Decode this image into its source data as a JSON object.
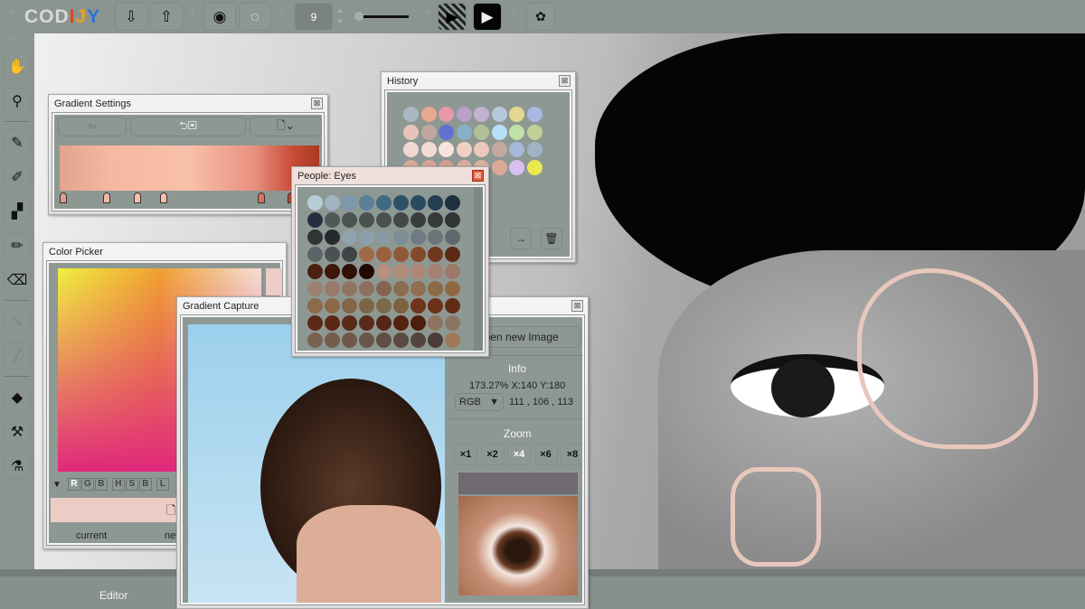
{
  "app": {
    "logo": "CODIJY",
    "brush_size": "9",
    "bottom_tab": "Editor"
  },
  "toolbar": {
    "icons": [
      "import-icon",
      "export-icon",
      "eye-icon",
      "dotted-circle-icon",
      "play-striped-icon",
      "play-icon",
      "gear-icon"
    ]
  },
  "tools": [
    "hand-icon",
    "magnifier-icon",
    "pencil-icon",
    "gradient-pencil-icon",
    "dither-pencil-icon",
    "outline-pencil-icon",
    "eraser-icon",
    "squiggle-icon",
    "line-icon",
    "paint-bucket-icon",
    "roller-icon",
    "eyedropper-icon"
  ],
  "gradient_settings": {
    "title": "Gradient Settings",
    "close": "x",
    "stops": [
      "#dca08a",
      "#f4b8a4",
      "#f8c0a8",
      "#f8bca6",
      "#d8705c",
      "#b84a30"
    ]
  },
  "color_picker": {
    "title": "Color Picker",
    "channels": [
      "R",
      "G",
      "B",
      "H",
      "S",
      "B",
      "L"
    ],
    "current_label": "current",
    "new_label": "new",
    "color": "#ecccc4"
  },
  "gradient_capture": {
    "title": "Gradient Capture",
    "close": "x",
    "open_button": "Open new Image",
    "info_heading": "Info",
    "info_line": "173.27% X:140 Y:180",
    "mode": "RGB",
    "rgb_values": "111 , 106 , 113",
    "zoom_heading": "Zoom",
    "zoom_options": [
      "×1",
      "×2",
      "×4",
      "×6",
      "×8"
    ],
    "zoom_selected": "×4"
  },
  "history": {
    "title": "History",
    "close": "x",
    "colors": [
      [
        "#a9b8c4",
        "#e8a890",
        "#e897a8",
        "#b9a0c8",
        "#c4b0d0",
        "#b8c8dc",
        "#e2d890",
        "#a8b8e0"
      ],
      [
        "#e8c4b8",
        "#c0a8a0",
        "#6070d0",
        "#88b0c8",
        "#b0c098",
        "#b8e0f4",
        "#c0e0a8",
        "#c0d098"
      ],
      [
        "#f0d8d0",
        "#f4dcd4",
        "#f8e4dc",
        "#f0d0c4",
        "#ecc8bc",
        "#c4a8a0",
        "#a8b8dc",
        "#a0b4c4"
      ],
      [
        "#d8a898",
        "#d4a494",
        "#d0a090",
        "#d8ac9c",
        "#dcb0a0",
        "#dca898",
        "#d8c0f0",
        "#e8e850"
      ]
    ]
  },
  "people_eyes": {
    "title": "People: Eyes",
    "close": "x",
    "colors": [
      [
        "#b8ccd8",
        "#a0b4c4",
        "#7c98ac",
        "#5a7f98",
        "#3f6a84",
        "#2c5068",
        "#2a4a60",
        "#263e52",
        "#1e3040"
      ],
      [
        "#243040",
        "#505858",
        "#4a5450",
        "#4a5250",
        "#4a5050",
        "#404848",
        "#383e3e",
        "#343a3a",
        "#303434"
      ],
      [
        "#303436",
        "#262a2c",
        "#8fa4b0",
        "#8aa0ac",
        "#8899a2",
        "#7c8c96",
        "#6e7a84",
        "#6a747a",
        "#60686e"
      ],
      [
        "#5c6468",
        "#4a5054",
        "#404446",
        "#a06a48",
        "#9a6040",
        "#905838",
        "#844a2c",
        "#70381c",
        "#5c2a14"
      ],
      [
        "#4a1e10",
        "#3e160a",
        "#321006",
        "#220804",
        "#b89080",
        "#b48c7c",
        "#ae8676",
        "#a48070",
        "#9c7868"
      ],
      [
        "#9c8070",
        "#987a6a",
        "#907460",
        "#8c705e",
        "#84644e",
        "#8c6c50",
        "#907050",
        "#8c6a48",
        "#906840"
      ],
      [
        "#8c6a4c",
        "#8a6848",
        "#866446",
        "#7c6444",
        "#7a6a48",
        "#7c6040",
        "#70341a",
        "#6a3018",
        "#602a14"
      ],
      [
        "#5a2a16",
        "#5a2814",
        "#582a18",
        "#5a2a18",
        "#582616",
        "#54220f",
        "#4c1e0e",
        "#8e7460",
        "#8a7464"
      ],
      [
        "#7a6250",
        "#745c4c",
        "#6e5848",
        "#68564a",
        "#604e44",
        "#5a4a42",
        "#544440",
        "#4a3c38",
        "#a07858"
      ]
    ]
  }
}
